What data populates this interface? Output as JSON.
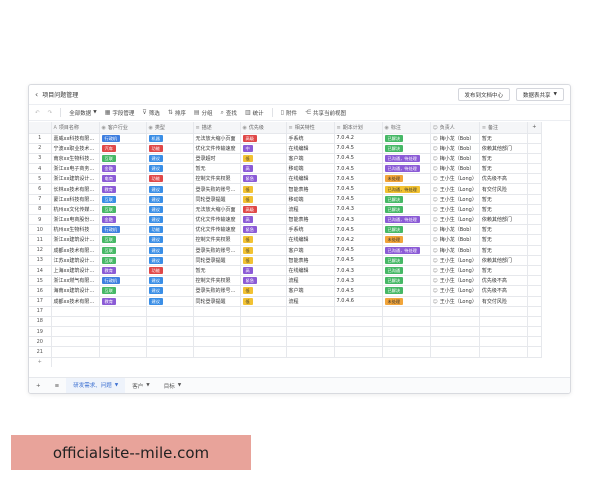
{
  "titlebar": {
    "title": "项目问题管理",
    "publish_btn": "发布到文档中心",
    "share_btn": "数据表共享"
  },
  "toolbar": {
    "undo": "↶",
    "redo": "↷",
    "all_data": "全部数据",
    "fields": "字段管理",
    "filter": "筛选",
    "sort": "排序",
    "group": "分组",
    "find": "查找",
    "stats": "统计",
    "attach": "附件",
    "share_view": "共享当前视图"
  },
  "columns": [
    "项目名称",
    "客户行业",
    "类型",
    "描述",
    "优先级",
    "相关特性",
    "期本计划",
    "标注",
    "负责人",
    "备注"
  ],
  "rows": [
    {
      "n": "1",
      "name": "嘉威xx科技有限…",
      "ind": [
        "行政机",
        "#3f7fe0"
      ],
      "type": [
        "机器",
        "#3a8ee6"
      ],
      "desc": "无法放大缩小页面",
      "pri": [
        "高级",
        "#e04848"
      ],
      "feat": "手系统",
      "ver": "7.0.4.2",
      "mark": [
        "已解决",
        "#46b866"
      ],
      "owner": "梅小龙（Bob）",
      "note": "暂无"
    },
    {
      "n": "2",
      "name": "宁波xx职业技术…",
      "ind": [
        "汽车",
        "#e04848"
      ],
      "type": [
        "功能",
        "#e04848"
      ],
      "desc": "优化文件传输速度",
      "pri": [
        "中",
        "#8b5bd6"
      ],
      "feat": "在线编辑",
      "ver": "7.0.4.5",
      "mark": [
        "已解决",
        "#46b866"
      ],
      "owner": "梅小龙（Bob）",
      "note": "依赖其他部门"
    },
    {
      "n": "3",
      "name": "南京xx生物科技…",
      "ind": [
        "互联",
        "#46b866"
      ],
      "type": [
        "建议",
        "#3a8ee6"
      ],
      "desc": "登录超时",
      "pri": [
        "低",
        "#f2c232"
      ],
      "feat": "客户端",
      "ver": "7.0.4.5",
      "mark": [
        "已沟通，待处理",
        "#8b5bd6"
      ],
      "owner": "梅小龙（Bob）",
      "note": "暂无"
    },
    {
      "n": "4",
      "name": "浙江xx电子商务…",
      "ind": [
        "金融",
        "#8b5bd6"
      ],
      "type": [
        "建议",
        "#3a8ee6"
      ],
      "desc": "暂无",
      "pri": [
        "高",
        "#8b5bd6"
      ],
      "feat": "移动端",
      "ver": "7.0.4.5",
      "mark": [
        "已沟通，待处理",
        "#8b5bd6"
      ],
      "owner": "梅小龙（Bob）",
      "note": "暂无"
    },
    {
      "n": "5",
      "name": "浙江xx建筑设计…",
      "ind": [
        "电商",
        "#8b5bd6"
      ],
      "type": [
        "功能",
        "#e04848"
      ],
      "desc": "控制文件夹权限",
      "pri": [
        "紧急",
        "#8b5bd6"
      ],
      "feat": "在线编辑",
      "ver": "7.0.4.5",
      "mark": [
        "未处理",
        "#f2a53a"
      ],
      "owner": "王小生（Long）",
      "note": "优先级不高"
    },
    {
      "n": "6",
      "name": "长林xx技术有限…",
      "ind": [
        "教育",
        "#8b5bd6"
      ],
      "type": [
        "建议",
        "#3a8ee6"
      ],
      "desc": "登录失败的账号…",
      "pri": [
        "低",
        "#f2c232"
      ],
      "feat": "智能表格",
      "ver": "7.0.4.5",
      "mark": [
        "已沟通，待处理",
        "#f2c232"
      ],
      "owner": "王小生（Long）",
      "note": "有交付风险"
    },
    {
      "n": "7",
      "name": "蒙江xx科技有限…",
      "ind": [
        "互联",
        "#3a8ee6"
      ],
      "type": [
        "建议",
        "#3a8ee6"
      ],
      "desc": "同轮登录提醒",
      "pri": [
        "低",
        "#f2c232"
      ],
      "feat": "移动端",
      "ver": "7.0.4.5",
      "mark": [
        "已解决",
        "#46b866"
      ],
      "owner": "王小生（Long）",
      "note": "暂无"
    },
    {
      "n": "8",
      "name": "杭州xx文化传媒…",
      "ind": [
        "互联",
        "#46b866"
      ],
      "type": [
        "建议",
        "#3a8ee6"
      ],
      "desc": "无法放大缩小页面",
      "pri": [
        "高级",
        "#e04848"
      ],
      "feat": "流程",
      "ver": "7.0.4.3",
      "mark": [
        "已解决",
        "#46b866"
      ],
      "owner": "王小生（Long）",
      "note": "暂无"
    },
    {
      "n": "9",
      "name": "浙江xx电商股份…",
      "ind": [
        "金融",
        "#8b5bd6"
      ],
      "type": [
        "建议",
        "#3a8ee6"
      ],
      "desc": "优化文件传输速度",
      "pri": [
        "高",
        "#8b5bd6"
      ],
      "feat": "智能表格",
      "ver": "7.0.4.3",
      "mark": [
        "已沟通，待处理",
        "#8b5bd6"
      ],
      "owner": "王小生（Long）",
      "note": "依赖其他部门"
    },
    {
      "n": "10",
      "name": "杭州xx生物科技",
      "ind": [
        "行政机",
        "#3f7fe0"
      ],
      "type": [
        "功能",
        "#3a8ee6"
      ],
      "desc": "优化文件传输速度",
      "pri": [
        "紧急",
        "#8b5bd6"
      ],
      "feat": "手系统",
      "ver": "7.0.4.5",
      "mark": [
        "已解决",
        "#46b866"
      ],
      "owner": "梅小龙（Bob）",
      "note": "暂无"
    },
    {
      "n": "11",
      "name": "浙江xx建筑设计…",
      "ind": [
        "互联",
        "#46b866"
      ],
      "type": [
        "建议",
        "#3a8ee6"
      ],
      "desc": "控制文件夹权限",
      "pri": [
        "低",
        "#f2c232"
      ],
      "feat": "在线编辑",
      "ver": "7.0.4.2",
      "mark": [
        "未处理",
        "#f2a53a"
      ],
      "owner": "梅小龙（Bob）",
      "note": "暂无"
    },
    {
      "n": "12",
      "name": "成都xx技术有限…",
      "ind": [
        "互联",
        "#46b866"
      ],
      "type": [
        "建议",
        "#3a8ee6"
      ],
      "desc": "登录失败的账号…",
      "pri": [
        "低",
        "#f2c232"
      ],
      "feat": "客户端",
      "ver": "7.0.4.5",
      "mark": [
        "已沟通，待处理",
        "#8b5bd6"
      ],
      "owner": "梅小龙（Bob）",
      "note": "暂无"
    },
    {
      "n": "13",
      "name": "江苏xx建筑设计…",
      "ind": [
        "互联",
        "#46b866"
      ],
      "type": [
        "建议",
        "#3a8ee6"
      ],
      "desc": "同轮登录提醒",
      "pri": [
        "低",
        "#f2c232"
      ],
      "feat": "智能表格",
      "ver": "7.0.4.5",
      "mark": [
        "已解决",
        "#46b866"
      ],
      "owner": "王小生（Long）",
      "note": "依赖其他部门"
    },
    {
      "n": "14",
      "name": "上海xx建筑设计…",
      "ind": [
        "教育",
        "#8b5bd6"
      ],
      "type": [
        "功能",
        "#e04848"
      ],
      "desc": "暂无",
      "pri": [
        "高",
        "#8b5bd6"
      ],
      "feat": "在线编辑",
      "ver": "7.0.4.3",
      "mark": [
        "已沟通",
        "#46b866"
      ],
      "owner": "王小生（Long）",
      "note": "暂无"
    },
    {
      "n": "15",
      "name": "浙江xx燃气有限…",
      "ind": [
        "行政机",
        "#3f7fe0"
      ],
      "type": [
        "建议",
        "#3a8ee6"
      ],
      "desc": "控制文件夹权限",
      "pri": [
        "紧急",
        "#8b5bd6"
      ],
      "feat": "流程",
      "ver": "7.0.4.3",
      "mark": [
        "已解决",
        "#46b866"
      ],
      "owner": "王小生（Long）",
      "note": "优先级不高"
    },
    {
      "n": "16",
      "name": "海南xx建筑设计…",
      "ind": [
        "互联",
        "#46b866"
      ],
      "type": [
        "建议",
        "#3a8ee6"
      ],
      "desc": "登录失败的账号…",
      "pri": [
        "低",
        "#f2c232"
      ],
      "feat": "客户端",
      "ver": "7.0.4.5",
      "mark": [
        "已解决",
        "#46b866"
      ],
      "owner": "王小生（Long）",
      "note": "优先级不高"
    },
    {
      "n": "17",
      "name": "成都xx技术有限…",
      "ind": [
        "教育",
        "#8b5bd6"
      ],
      "type": [
        "建议",
        "#3a8ee6"
      ],
      "desc": "同轮登录提醒",
      "pri": [
        "低",
        "#f2c232"
      ],
      "feat": "流程",
      "ver": "7.0.4.6",
      "mark": [
        "未处理",
        "#f2a53a"
      ],
      "owner": "王小生（Long）",
      "note": "有交付风险"
    },
    {
      "n": "17",
      "empty": true
    },
    {
      "n": "18",
      "empty": true
    },
    {
      "n": "19",
      "empty": true
    },
    {
      "n": "20",
      "empty": true
    },
    {
      "n": "21",
      "empty": true
    }
  ],
  "add_row": "+",
  "bottom": {
    "add": "+",
    "list": "≡",
    "tabs": [
      "研发需求、问题",
      "客户",
      "目标"
    ]
  },
  "banner": {
    "text": "officialsite--mile.com"
  }
}
